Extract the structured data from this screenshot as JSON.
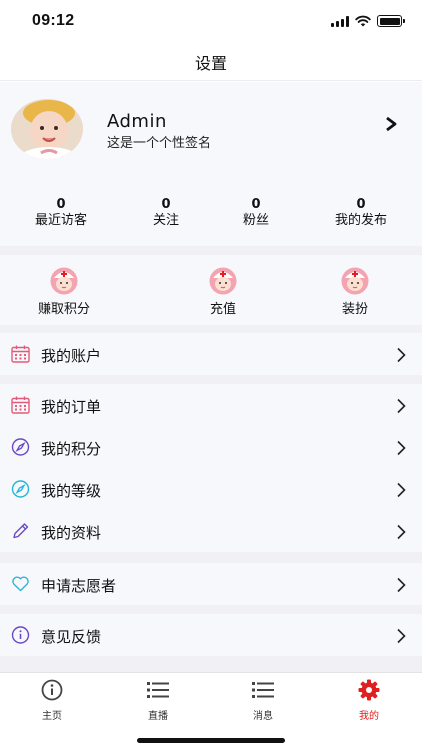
{
  "status_bar": {
    "time": "09:12"
  },
  "nav": {
    "title": "设置"
  },
  "profile": {
    "name": "Admin",
    "signature": "这是一个个性签名"
  },
  "stats": [
    {
      "value": "0",
      "label": "最近访客"
    },
    {
      "value": "0",
      "label": "关注"
    },
    {
      "value": "0",
      "label": "粉丝"
    },
    {
      "value": "0",
      "label": "我的发布"
    }
  ],
  "services": [
    {
      "label": "赚取积分",
      "icon": "nurse-icon"
    },
    {
      "label": "充值",
      "icon": "nurse-icon"
    },
    {
      "label": "装扮",
      "icon": "nurse-icon"
    }
  ],
  "menu": {
    "account": {
      "label": "我的账户",
      "icon": "calendar-icon"
    },
    "orders": {
      "label": "我的订单",
      "icon": "calendar-icon"
    },
    "points": {
      "label": "我的积分",
      "icon": "compass-icon"
    },
    "level": {
      "label": "我的等级",
      "icon": "compass-icon"
    },
    "profile_info": {
      "label": "我的资料",
      "icon": "pencil-icon"
    },
    "volunteer": {
      "label": "申请志愿者",
      "icon": "heart-icon"
    },
    "feedback": {
      "label": "意见反馈",
      "icon": "info-icon"
    }
  },
  "tabs": [
    {
      "label": "主页",
      "icon": "info-icon"
    },
    {
      "label": "直播",
      "icon": "list-icon"
    },
    {
      "label": "消息",
      "icon": "list-icon"
    },
    {
      "label": "我的",
      "icon": "gear-icon"
    }
  ],
  "colors": {
    "accent": "#e02020",
    "calendar": "#e35b7a",
    "compass_purple": "#6b48c8",
    "compass_cyan": "#28b5d6",
    "heart": "#29b6d9",
    "info": "#6b48c8"
  }
}
